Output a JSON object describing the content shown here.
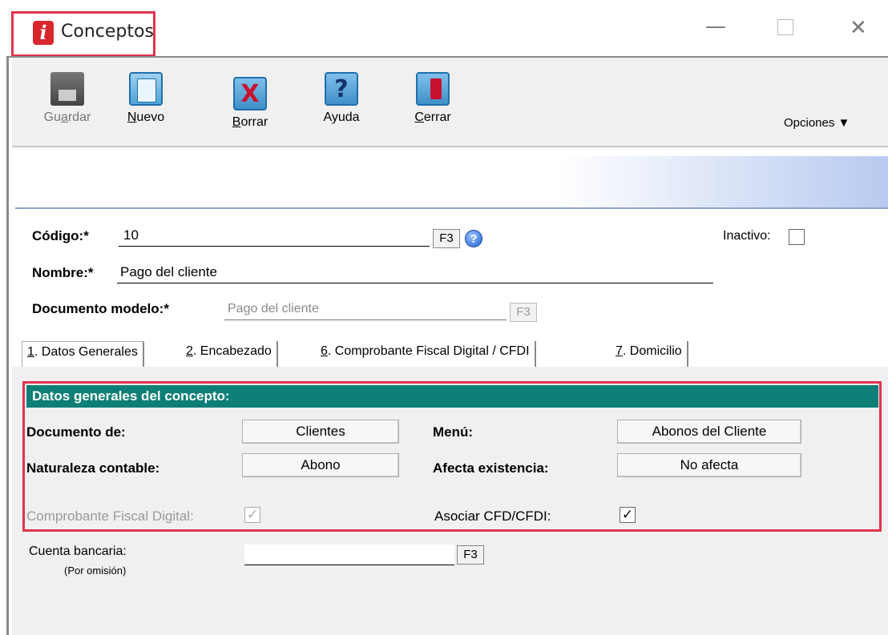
{
  "window": {
    "title": "Conceptos"
  },
  "toolbar": {
    "save_label": "Guardar",
    "new_label": "Nuevo",
    "delete_label": "Borrar",
    "help_label": "Ayuda",
    "close_label": "Cerrar",
    "options_label": "Opciones ▼"
  },
  "form": {
    "code_label": "Código:*",
    "code_value": "10",
    "f3": "F3",
    "inactive_label": "Inactivo:",
    "name_label": "Nombre:*",
    "name_value": "Pago del cliente",
    "model_label": "Documento modelo:*",
    "model_value": "Pago del cliente"
  },
  "tabs": [
    {
      "num": "1",
      "rest": ". Datos Generales"
    },
    {
      "num": "2",
      "rest": ". Encabezado"
    },
    {
      "num": "6",
      "rest": ". Comprobante Fiscal Digital / CFDI"
    },
    {
      "num": "7",
      "rest": ". Domicilio"
    }
  ],
  "general": {
    "header": "Datos generales del concepto:",
    "document_of_label": "Documento de:",
    "document_of_value": "Clientes",
    "menu_label": "Menú:",
    "menu_value": "Abonos del Cliente",
    "nature_label": "Naturaleza contable:",
    "nature_value": "Abono",
    "affects_stock_label": "Afecta existencia:",
    "affects_stock_value": "No afecta",
    "cfd_label": "Comprobante Fiscal Digital:",
    "associate_label": "Asociar CFD/CFDI:",
    "bank_account_label": "Cuenta bancaria:",
    "bank_account_sub": "(Por omisión)",
    "bank_account_value": ""
  },
  "colors": {
    "panel_header": "#0e7f76",
    "highlight": "#e0334f"
  }
}
